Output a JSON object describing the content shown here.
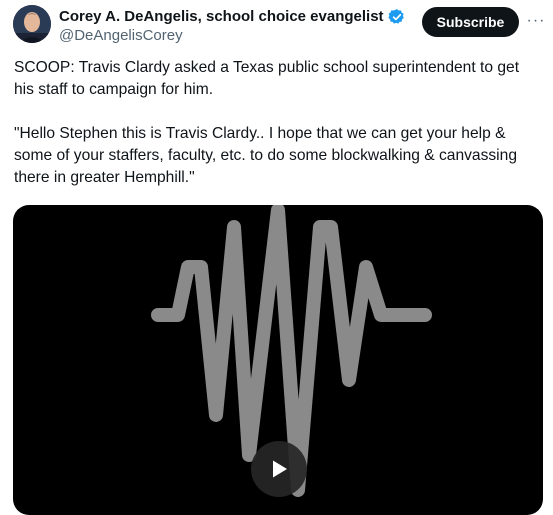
{
  "author": {
    "display_name": "Corey A. DeAngelis, school choice evangelist",
    "handle": "@DeAngelisCorey",
    "verified_badge_icon": "verified-badge-icon"
  },
  "actions": {
    "subscribe_label": "Subscribe",
    "more_icon": "more-horizontal-icon",
    "more_glyph": "···"
  },
  "tweet": {
    "paragraphs": [
      "SCOOP: Travis Clardy asked a Texas public school superintendent to get his staff to campaign for him.",
      "\"Hello Stephen this is Travis Clardy.. I hope that we can get your help & some of your staffers, faculty, etc. to do some blockwalking & canvassing there in greater Hemphill.\""
    ]
  },
  "media": {
    "type": "video",
    "play_icon": "play-icon",
    "waveform_icon": "audio-waveform-icon"
  },
  "colors": {
    "text_primary": "#0f1419",
    "text_secondary": "#536471",
    "verified_blue": "#1d9bf0",
    "button_bg": "#0f1419",
    "media_bg": "#000000",
    "waveform": "#8a8a8a"
  }
}
